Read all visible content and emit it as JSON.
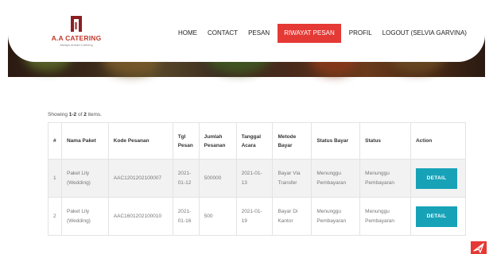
{
  "brand": {
    "name": "A.A CATERING",
    "tagline": "Always Ahead Catering",
    "color": "#c0392b",
    "mark_color": "#8a1f22"
  },
  "nav": {
    "items": [
      {
        "label": "HOME",
        "active": false
      },
      {
        "label": "CONTACT",
        "active": false
      },
      {
        "label": "PESAN",
        "active": false
      },
      {
        "label": "RIWAYAT PESAN",
        "active": true
      },
      {
        "label": "PROFIL",
        "active": false
      },
      {
        "label": "LOGOUT (SELVIA GARVINA)",
        "active": false
      }
    ],
    "active_color": "#e53935"
  },
  "summary": {
    "prefix": "Showing ",
    "range": "1-2",
    "middle": " of ",
    "total": "2",
    "suffix": " items."
  },
  "table": {
    "headers": [
      "#",
      "Nama Paket",
      "Kode Pesanan",
      "Tgl Pesan",
      "Jumlah Pesanan",
      "Tanggal Acara",
      "Metode Bayar",
      "Status Bayar",
      "Status",
      "Action"
    ],
    "rows": [
      {
        "no": "1",
        "nama_paket": "Paket Lily (Wedding)",
        "kode": "AAC1201202100007",
        "tgl_pesan": "2021-01-12",
        "jumlah": "500000",
        "tanggal_acara": "2021-01-13",
        "metode": "Bayar Via Transfer",
        "status_bayar": "Menunggu Pembayaran",
        "status": "Menunggu Pembayaran",
        "action": "DETAIL"
      },
      {
        "no": "2",
        "nama_paket": "Paket Lily (Wedding)",
        "kode": "AAC1601202100010",
        "tgl_pesan": "2021-01-16",
        "jumlah": "500",
        "tanggal_acara": "2021-01-19",
        "metode": "Bayar Di Kantor",
        "status_bayar": "Menunggu Pembayaran",
        "status": "Menunggu Pembayaran",
        "action": "DETAIL"
      }
    ],
    "button_color": "#17a2b8"
  },
  "icons": {
    "floating": "paper-plane-icon",
    "floating_color": "#e53935"
  }
}
